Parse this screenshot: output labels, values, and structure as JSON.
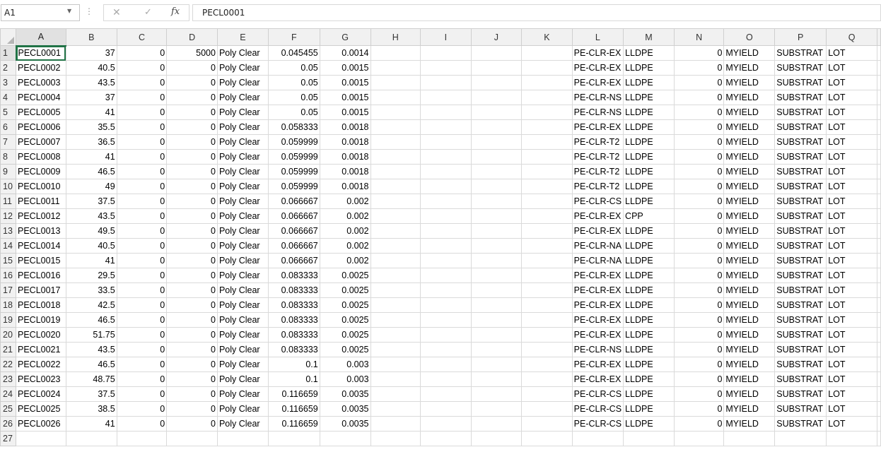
{
  "formula_bar": {
    "name_box": "A1",
    "dots": "⋮",
    "cancel_symbol": "✕",
    "enter_symbol": "✓",
    "fx_symbol": "fx",
    "content": "PECL0001"
  },
  "sheet": {
    "columns": [
      "A",
      "B",
      "C",
      "D",
      "E",
      "F",
      "G",
      "H",
      "I",
      "J",
      "K",
      "L",
      "M",
      "N",
      "O",
      "P",
      "Q"
    ],
    "rows": [
      [
        "PECL0001",
        "37",
        "0",
        "5000",
        "Poly Clear",
        "0.045455",
        "0.0014",
        "",
        "",
        "",
        "",
        "PE-CLR-EX",
        "LLDPE",
        "0",
        "MYIELD",
        "SUBSTRAT",
        "LOT"
      ],
      [
        "PECL0002",
        "40.5",
        "0",
        "0",
        "Poly Clear",
        "0.05",
        "0.0015",
        "",
        "",
        "",
        "",
        "PE-CLR-EX",
        "LLDPE",
        "0",
        "MYIELD",
        "SUBSTRAT",
        "LOT"
      ],
      [
        "PECL0003",
        "43.5",
        "0",
        "0",
        "Poly Clear",
        "0.05",
        "0.0015",
        "",
        "",
        "",
        "",
        "PE-CLR-EX",
        "LLDPE",
        "0",
        "MYIELD",
        "SUBSTRAT",
        "LOT"
      ],
      [
        "PECL0004",
        "37",
        "0",
        "0",
        "Poly Clear",
        "0.05",
        "0.0015",
        "",
        "",
        "",
        "",
        "PE-CLR-NS",
        "LLDPE",
        "0",
        "MYIELD",
        "SUBSTRAT",
        "LOT"
      ],
      [
        "PECL0005",
        "41",
        "0",
        "0",
        "Poly Clear",
        "0.05",
        "0.0015",
        "",
        "",
        "",
        "",
        "PE-CLR-NS",
        "LLDPE",
        "0",
        "MYIELD",
        "SUBSTRAT",
        "LOT"
      ],
      [
        "PECL0006",
        "35.5",
        "0",
        "0",
        "Poly Clear",
        "0.058333",
        "0.0018",
        "",
        "",
        "",
        "",
        "PE-CLR-EX",
        "LLDPE",
        "0",
        "MYIELD",
        "SUBSTRAT",
        "LOT"
      ],
      [
        "PECL0007",
        "36.5",
        "0",
        "0",
        "Poly Clear",
        "0.059999",
        "0.0018",
        "",
        "",
        "",
        "",
        "PE-CLR-T2",
        "LLDPE",
        "0",
        "MYIELD",
        "SUBSTRAT",
        "LOT"
      ],
      [
        "PECL0008",
        "41",
        "0",
        "0",
        "Poly Clear",
        "0.059999",
        "0.0018",
        "",
        "",
        "",
        "",
        "PE-CLR-T2",
        "LLDPE",
        "0",
        "MYIELD",
        "SUBSTRAT",
        "LOT"
      ],
      [
        "PECL0009",
        "46.5",
        "0",
        "0",
        "Poly Clear",
        "0.059999",
        "0.0018",
        "",
        "",
        "",
        "",
        "PE-CLR-T2",
        "LLDPE",
        "0",
        "MYIELD",
        "SUBSTRAT",
        "LOT"
      ],
      [
        "PECL0010",
        "49",
        "0",
        "0",
        "Poly Clear",
        "0.059999",
        "0.0018",
        "",
        "",
        "",
        "",
        "PE-CLR-T2",
        "LLDPE",
        "0",
        "MYIELD",
        "SUBSTRAT",
        "LOT"
      ],
      [
        "PECL0011",
        "37.5",
        "0",
        "0",
        "Poly Clear",
        "0.066667",
        "0.002",
        "",
        "",
        "",
        "",
        "PE-CLR-CS",
        "LLDPE",
        "0",
        "MYIELD",
        "SUBSTRAT",
        "LOT"
      ],
      [
        "PECL0012",
        "43.5",
        "0",
        "0",
        "Poly Clear",
        "0.066667",
        "0.002",
        "",
        "",
        "",
        "",
        "PE-CLR-EX",
        "CPP",
        "0",
        "MYIELD",
        "SUBSTRAT",
        "LOT"
      ],
      [
        "PECL0013",
        "49.5",
        "0",
        "0",
        "Poly Clear",
        "0.066667",
        "0.002",
        "",
        "",
        "",
        "",
        "PE-CLR-EX",
        "LLDPE",
        "0",
        "MYIELD",
        "SUBSTRAT",
        "LOT"
      ],
      [
        "PECL0014",
        "40.5",
        "0",
        "0",
        "Poly Clear",
        "0.066667",
        "0.002",
        "",
        "",
        "",
        "",
        "PE-CLR-NA",
        "LLDPE",
        "0",
        "MYIELD",
        "SUBSTRAT",
        "LOT"
      ],
      [
        "PECL0015",
        "41",
        "0",
        "0",
        "Poly Clear",
        "0.066667",
        "0.002",
        "",
        "",
        "",
        "",
        "PE-CLR-NA",
        "LLDPE",
        "0",
        "MYIELD",
        "SUBSTRAT",
        "LOT"
      ],
      [
        "PECL0016",
        "29.5",
        "0",
        "0",
        "Poly Clear",
        "0.083333",
        "0.0025",
        "",
        "",
        "",
        "",
        "PE-CLR-EX",
        "LLDPE",
        "0",
        "MYIELD",
        "SUBSTRAT",
        "LOT"
      ],
      [
        "PECL0017",
        "33.5",
        "0",
        "0",
        "Poly Clear",
        "0.083333",
        "0.0025",
        "",
        "",
        "",
        "",
        "PE-CLR-EX",
        "LLDPE",
        "0",
        "MYIELD",
        "SUBSTRAT",
        "LOT"
      ],
      [
        "PECL0018",
        "42.5",
        "0",
        "0",
        "Poly Clear",
        "0.083333",
        "0.0025",
        "",
        "",
        "",
        "",
        "PE-CLR-EX",
        "LLDPE",
        "0",
        "MYIELD",
        "SUBSTRAT",
        "LOT"
      ],
      [
        "PECL0019",
        "46.5",
        "0",
        "0",
        "Poly Clear",
        "0.083333",
        "0.0025",
        "",
        "",
        "",
        "",
        "PE-CLR-EX",
        "LLDPE",
        "0",
        "MYIELD",
        "SUBSTRAT",
        "LOT"
      ],
      [
        "PECL0020",
        "51.75",
        "0",
        "0",
        "Poly Clear",
        "0.083333",
        "0.0025",
        "",
        "",
        "",
        "",
        "PE-CLR-EX",
        "LLDPE",
        "0",
        "MYIELD",
        "SUBSTRAT",
        "LOT"
      ],
      [
        "PECL0021",
        "43.5",
        "0",
        "0",
        "Poly Clear",
        "0.083333",
        "0.0025",
        "",
        "",
        "",
        "",
        "PE-CLR-NS",
        "LLDPE",
        "0",
        "MYIELD",
        "SUBSTRAT",
        "LOT"
      ],
      [
        "PECL0022",
        "46.5",
        "0",
        "0",
        "Poly Clear",
        "0.1",
        "0.003",
        "",
        "",
        "",
        "",
        "PE-CLR-EX",
        "LLDPE",
        "0",
        "MYIELD",
        "SUBSTRAT",
        "LOT"
      ],
      [
        "PECL0023",
        "48.75",
        "0",
        "0",
        "Poly Clear",
        "0.1",
        "0.003",
        "",
        "",
        "",
        "",
        "PE-CLR-EX",
        "LLDPE",
        "0",
        "MYIELD",
        "SUBSTRAT",
        "LOT"
      ],
      [
        "PECL0024",
        "37.5",
        "0",
        "0",
        "Poly Clear",
        "0.116659",
        "0.0035",
        "",
        "",
        "",
        "",
        "PE-CLR-CS",
        "LLDPE",
        "0",
        "MYIELD",
        "SUBSTRAT",
        "LOT"
      ],
      [
        "PECL0025",
        "38.5",
        "0",
        "0",
        "Poly Clear",
        "0.116659",
        "0.0035",
        "",
        "",
        "",
        "",
        "PE-CLR-CS",
        "LLDPE",
        "0",
        "MYIELD",
        "SUBSTRAT",
        "LOT"
      ],
      [
        "PECL0026",
        "41",
        "0",
        "0",
        "Poly Clear",
        "0.116659",
        "0.0035",
        "",
        "",
        "",
        "",
        "PE-CLR-CS",
        "LLDPE",
        "0",
        "MYIELD",
        "SUBSTRAT",
        "LOT"
      ]
    ],
    "next_row_number": "27",
    "active_cell": "A1",
    "accent_color": "#217346"
  }
}
